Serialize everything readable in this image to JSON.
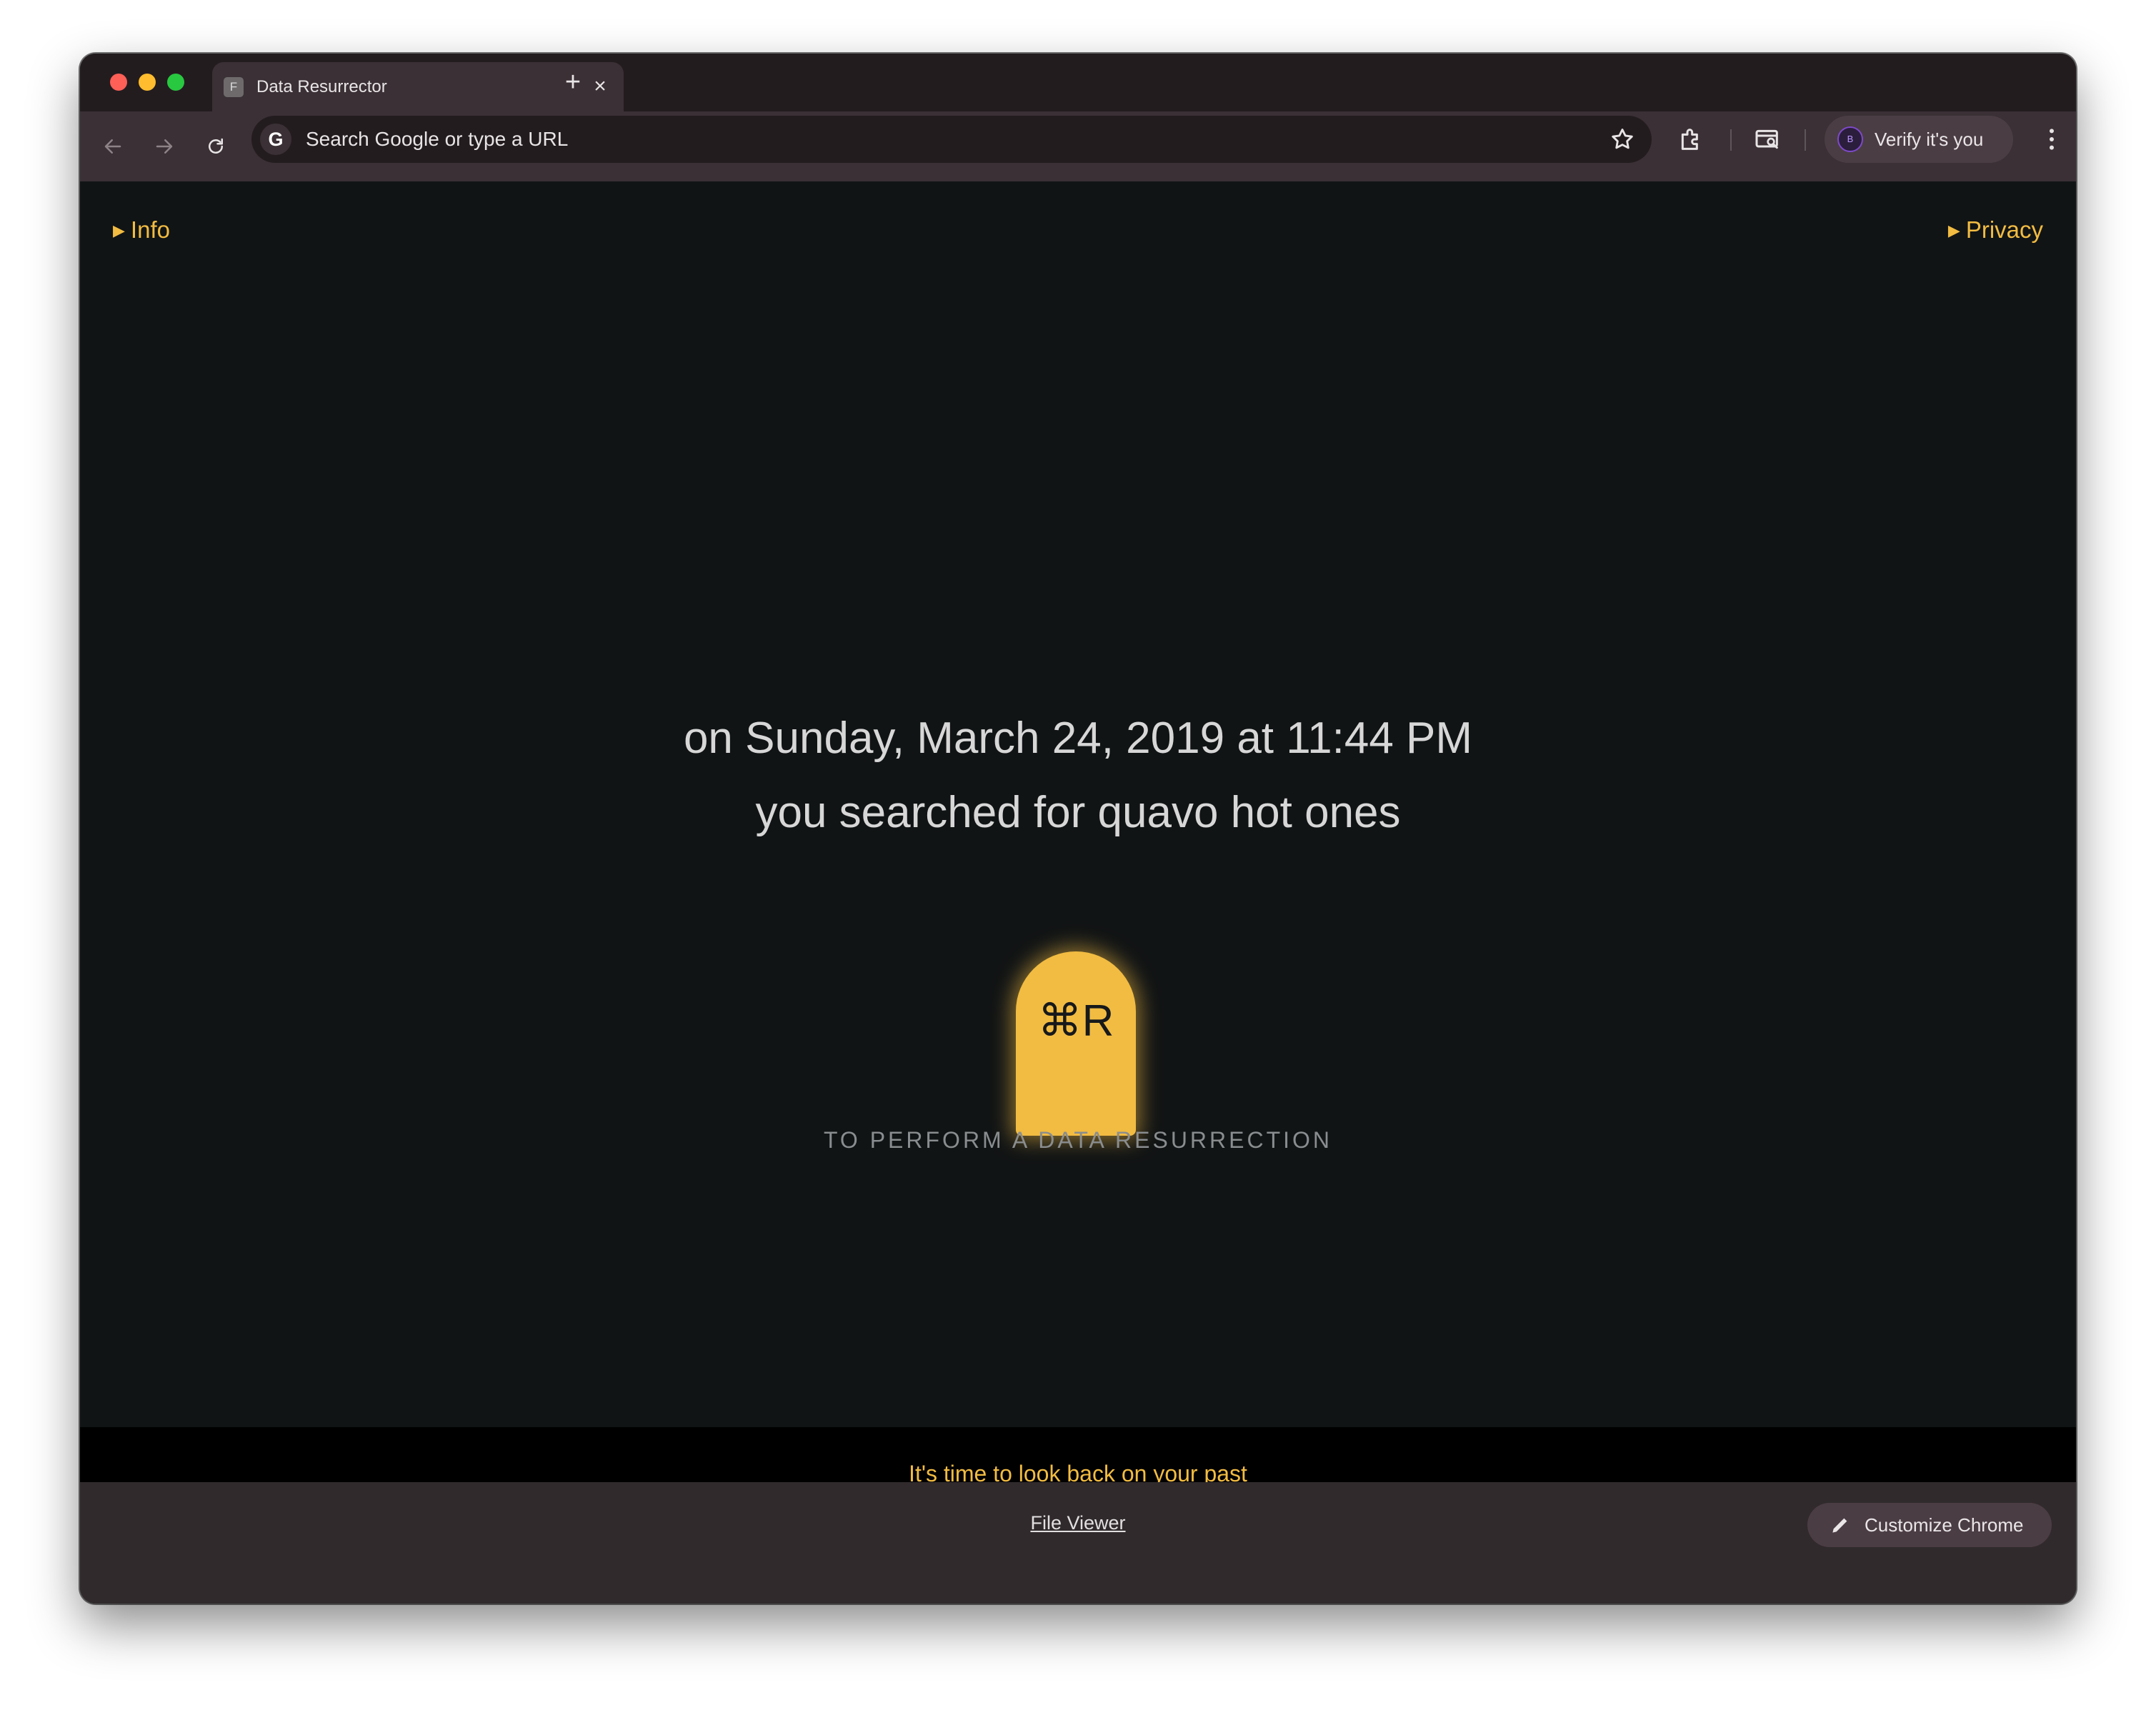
{
  "browser": {
    "tab": {
      "favicon_letter": "F",
      "title": "Data Resurrector",
      "close_label": "×"
    },
    "new_tab_label": "+",
    "omnibox": {
      "placeholder": "Search Google or type a URL",
      "engine_letter": "G"
    },
    "profile": {
      "avatar_letter": "B",
      "label": "Verify it's you"
    },
    "icons": [
      "back-arrow-icon",
      "forward-arrow-icon",
      "reload-icon",
      "bookmark-star-icon",
      "extensions-puzzle-icon",
      "tab-search-icon",
      "kebab-menu-icon"
    ]
  },
  "page": {
    "info_label": "Info",
    "privacy_label": "Privacy",
    "headline_line1": "on Sunday, March 24, 2019 at 11:44 PM",
    "headline_line2": "you searched for quavo hot ones",
    "tombstone_shortcut": "⌘R",
    "instruction": "TO PERFORM A DATA RESURRECTION",
    "banner_text": "It's time to look back on your past",
    "accent_color": "#f2bc42",
    "background_color": "#111415"
  },
  "footer": {
    "file_viewer_label": "File Viewer",
    "customize_label": "Customize Chrome"
  }
}
